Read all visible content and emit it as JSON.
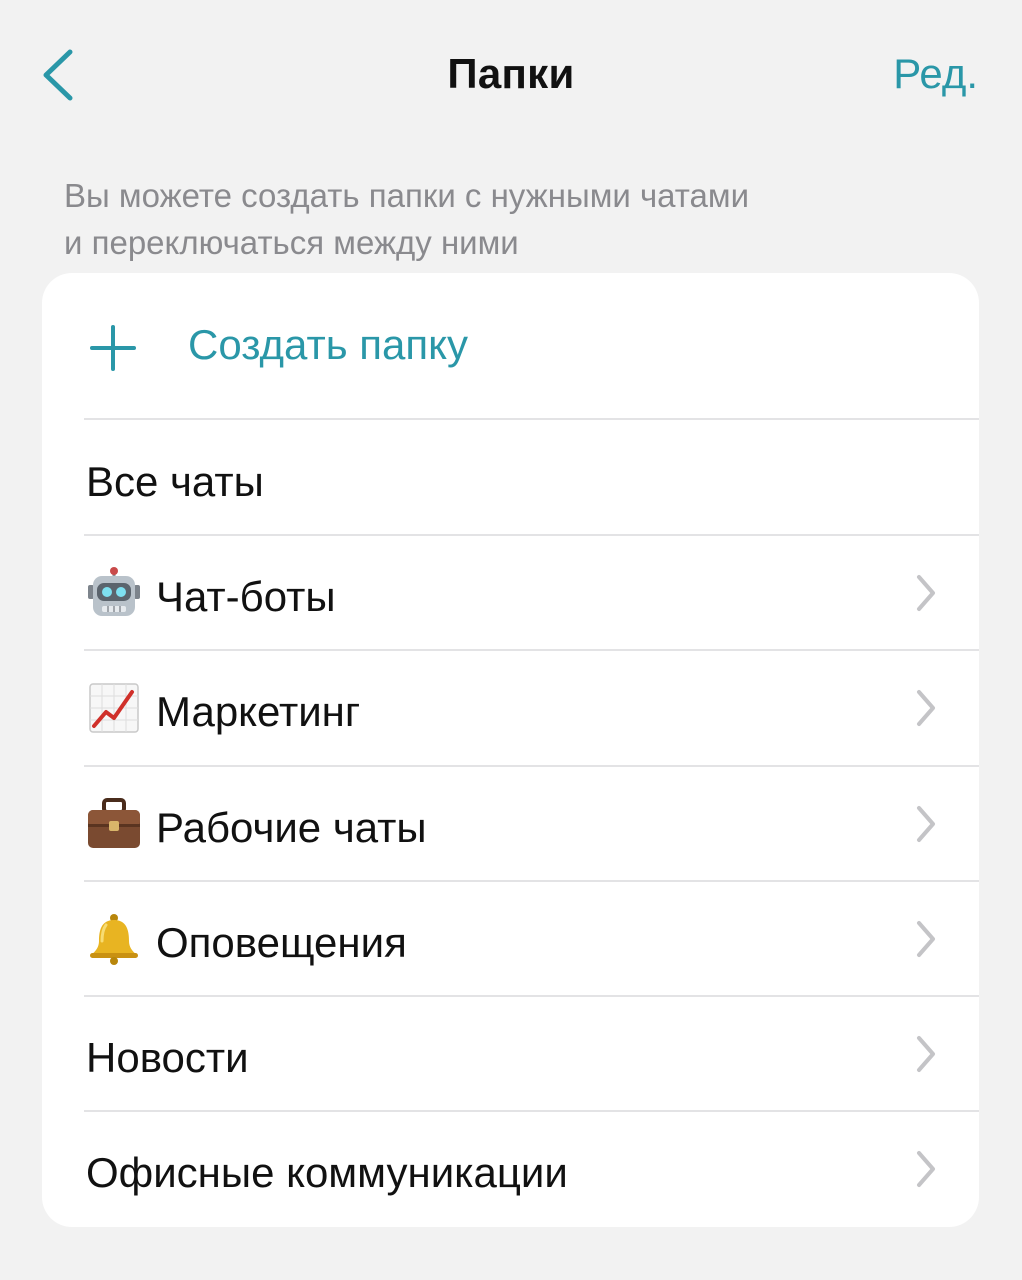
{
  "header": {
    "back_icon": "chevron-left-icon",
    "title": "Папки",
    "edit_label": "Ред."
  },
  "description": {
    "line1": "Вы можете создать папки с нужными чатами",
    "line2": "и переключаться между ними"
  },
  "create_folder": {
    "icon": "plus-icon",
    "label": "Создать папку"
  },
  "folders": [
    {
      "label": "Все чаты",
      "icon": "",
      "has_chevron": false
    },
    {
      "label": "Чат-боты",
      "icon": "robot-icon",
      "has_chevron": true
    },
    {
      "label": "Маркетинг",
      "icon": "chart-increasing-icon",
      "has_chevron": true
    },
    {
      "label": "Рабочие чаты",
      "icon": "briefcase-icon",
      "has_chevron": true
    },
    {
      "label": "Оповещения",
      "icon": "bell-icon",
      "has_chevron": true
    },
    {
      "label": "Новости",
      "icon": "",
      "has_chevron": true
    },
    {
      "label": "Офисные коммуникации",
      "icon": "",
      "has_chevron": true
    }
  ],
  "colors": {
    "accent": "#2a97a8",
    "background": "#f2f2f2",
    "card": "#ffffff",
    "text": "#111111",
    "secondary_text": "#8a8a8e",
    "chevron": "#c4c4c7"
  }
}
